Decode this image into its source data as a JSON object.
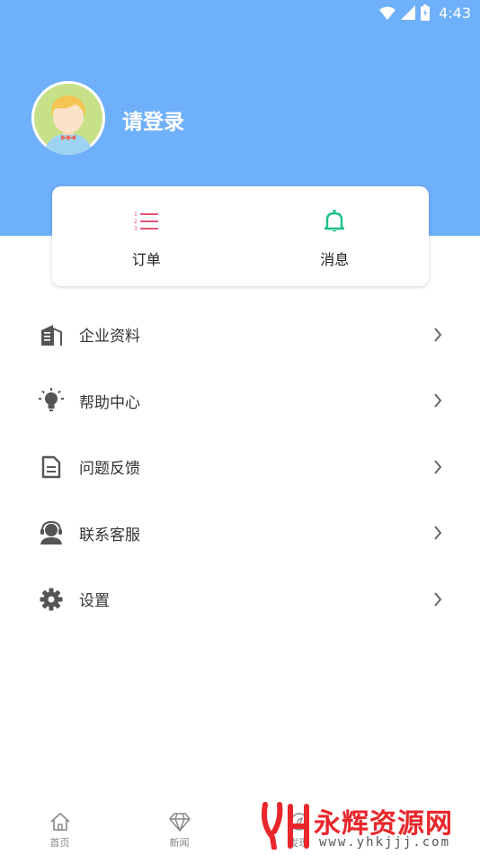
{
  "status_bar": {
    "time": "4:43",
    "icons": [
      "wifi-icon",
      "signal-icon",
      "battery-icon"
    ]
  },
  "profile": {
    "login_text": "请登录",
    "avatar": "avatar-icon"
  },
  "quick_actions": [
    {
      "label": "订单",
      "icon": "list-icon",
      "color": "#e05576"
    },
    {
      "label": "消息",
      "icon": "bell-icon",
      "color": "#1fbf8a"
    }
  ],
  "menu": [
    {
      "label": "企业资料",
      "icon": "building-icon"
    },
    {
      "label": "帮助中心",
      "icon": "lightbulb-icon"
    },
    {
      "label": "问题反馈",
      "icon": "document-icon"
    },
    {
      "label": "联系客服",
      "icon": "headset-icon"
    },
    {
      "label": "设置",
      "icon": "gear-icon"
    }
  ],
  "bottom_nav": [
    {
      "label": "首页",
      "icon": "home-icon"
    },
    {
      "label": "新闻",
      "icon": "diamond-icon"
    },
    {
      "label": "发现",
      "icon": "discover-icon"
    }
  ],
  "watermark": {
    "title": "永辉资源网",
    "url": "www.yhkjjj.com"
  },
  "colors": {
    "header": "#6fb0fb",
    "order_accent": "#e05576",
    "message_accent": "#1fbf8a",
    "icon_gray": "#555555",
    "watermark_red": "#e8262b"
  }
}
